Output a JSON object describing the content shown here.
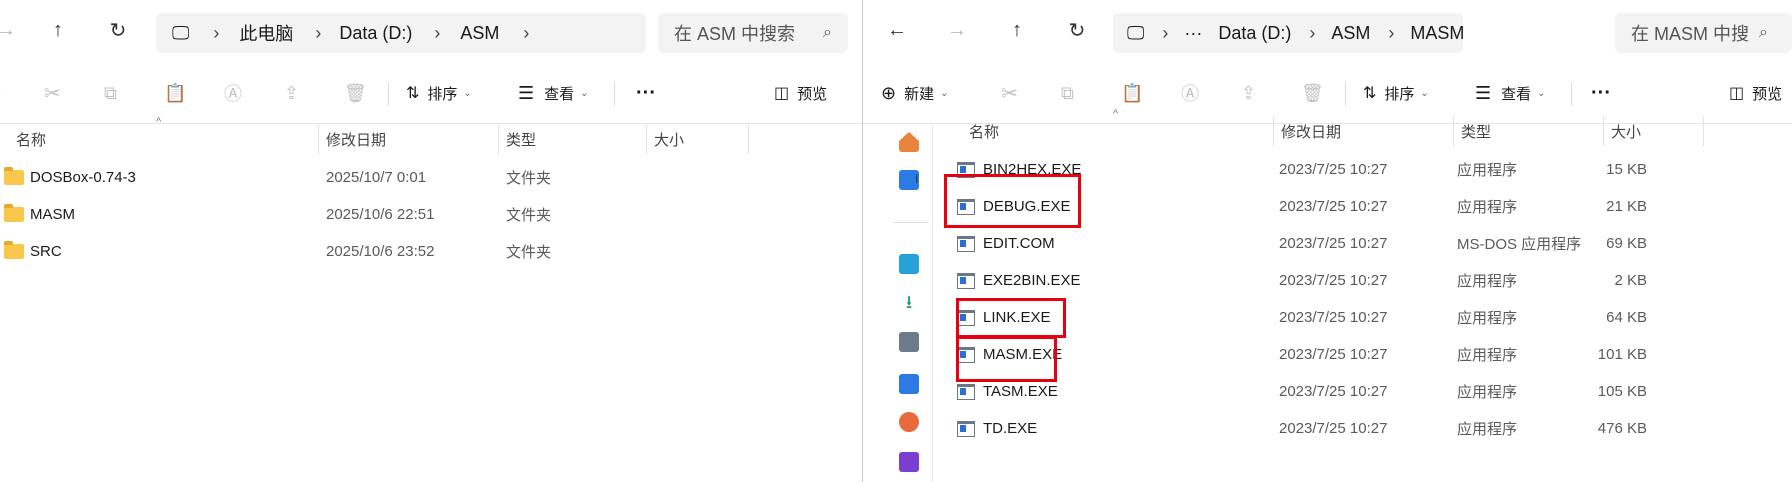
{
  "left": {
    "address": {
      "segments": [
        "此电脑",
        "Data (D:)",
        "ASM"
      ]
    },
    "search_placeholder": "在 ASM 中搜索",
    "toolbar": {
      "sort_label": "排序",
      "view_label": "查看",
      "preview_label": "预览"
    },
    "columns": [
      "名称",
      "修改日期",
      "类型",
      "大小"
    ],
    "rows": [
      {
        "name": "DOSBox-0.74-3",
        "date": "2025/10/7 0:01",
        "type": "文件夹"
      },
      {
        "name": "MASM",
        "date": "2025/10/6 22:51",
        "type": "文件夹"
      },
      {
        "name": "SRC",
        "date": "2025/10/6 23:52",
        "type": "文件夹"
      }
    ]
  },
  "right": {
    "address": {
      "ellipsis": "···",
      "segments": [
        "Data (D:)",
        "ASM",
        "MASM"
      ]
    },
    "search_placeholder": "在 MASM 中搜",
    "toolbar": {
      "new_label": "新建",
      "sort_label": "排序",
      "view_label": "查看",
      "preview_label": "预览"
    },
    "columns": [
      "名称",
      "修改日期",
      "类型",
      "大小"
    ],
    "rows": [
      {
        "name": "BIN2HEX.EXE",
        "date": "2023/7/25 10:27",
        "type": "应用程序",
        "size": "15 KB"
      },
      {
        "name": "DEBUG.EXE",
        "date": "2023/7/25 10:27",
        "type": "应用程序",
        "size": "21 KB"
      },
      {
        "name": "EDIT.COM",
        "date": "2023/7/25 10:27",
        "type": "MS-DOS 应用程序",
        "size": "69 KB"
      },
      {
        "name": "EXE2BIN.EXE",
        "date": "2023/7/25 10:27",
        "type": "应用程序",
        "size": "2 KB"
      },
      {
        "name": "LINK.EXE",
        "date": "2023/7/25 10:27",
        "type": "应用程序",
        "size": "64 KB"
      },
      {
        "name": "MASM.EXE",
        "date": "2023/7/25 10:27",
        "type": "应用程序",
        "size": "101 KB"
      },
      {
        "name": "TASM.EXE",
        "date": "2023/7/25 10:27",
        "type": "应用程序",
        "size": "105 KB"
      },
      {
        "name": "TD.EXE",
        "date": "2023/7/25 10:27",
        "type": "应用程序",
        "size": "476 KB"
      }
    ]
  },
  "colors": {
    "highlight": "#e60012",
    "folder": "#f8c74b"
  }
}
